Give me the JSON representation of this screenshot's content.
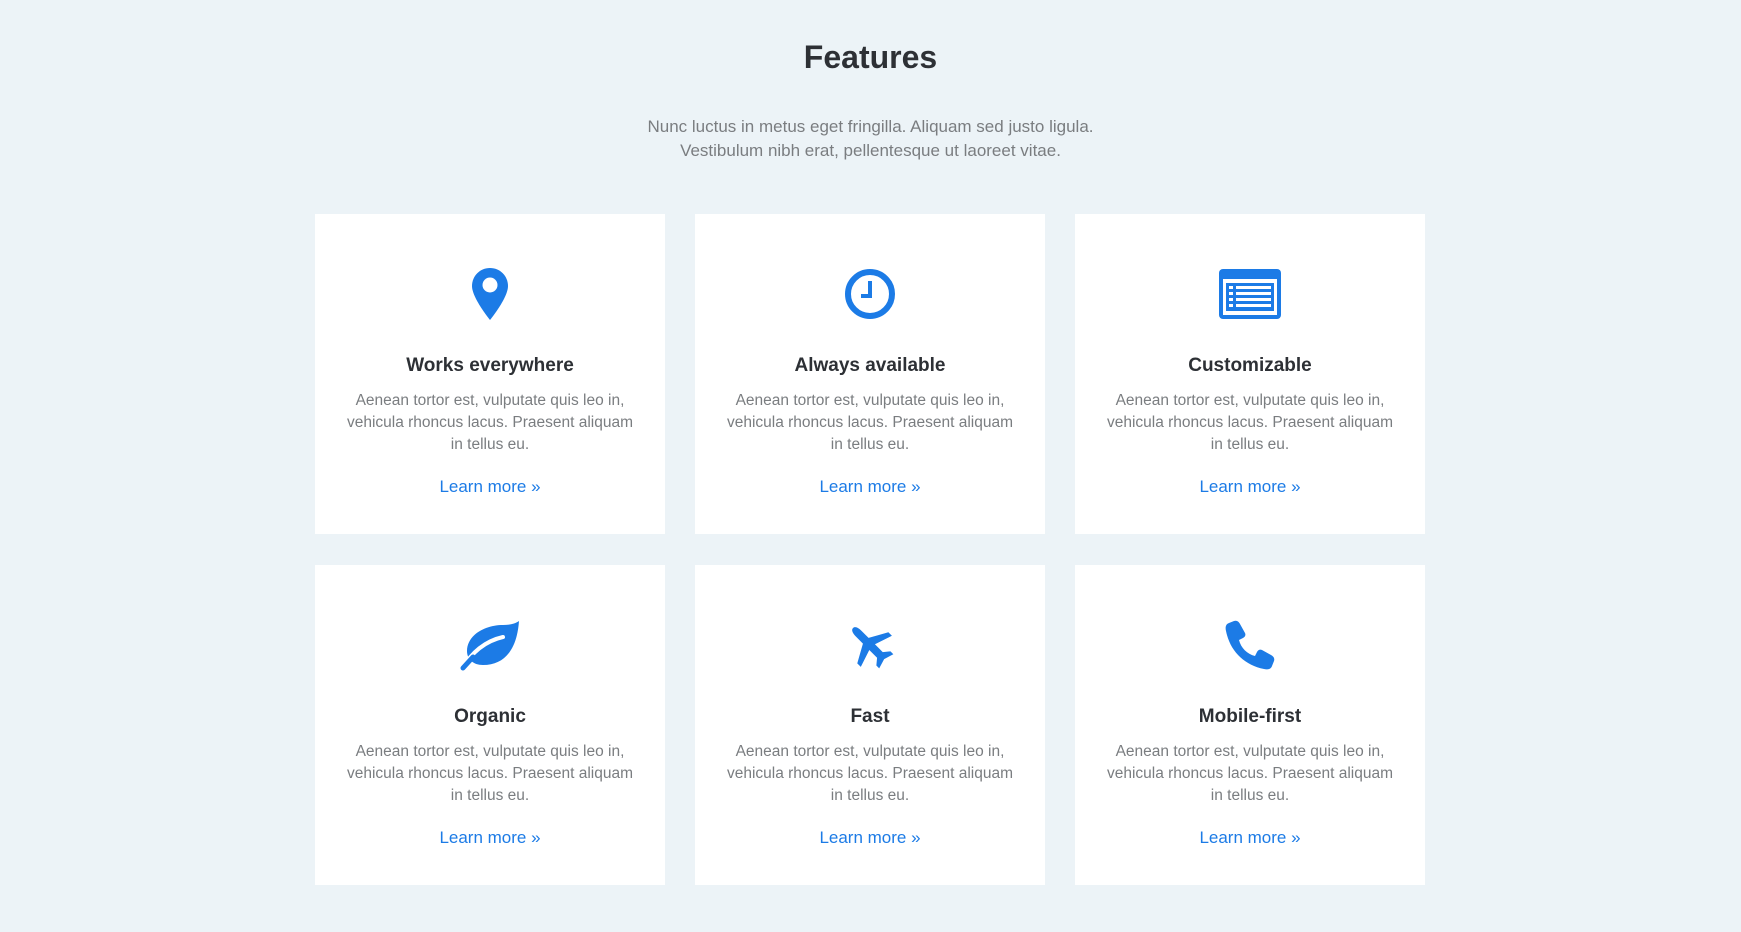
{
  "header": {
    "title": "Features",
    "subtitle_line1": "Nunc luctus in metus eget fringilla. Aliquam sed justo ligula.",
    "subtitle_line2": "Vestibulum nibh erat, pellentesque ut laoreet vitae."
  },
  "accent_color": "#1c7be6",
  "features": [
    {
      "icon": "map-marker-icon",
      "title": "Works everywhere",
      "text": "Aenean tortor est, vulputate quis leo in, vehicula rhoncus lacus. Praesent aliquam in tellus eu.",
      "link": "Learn more »"
    },
    {
      "icon": "clock-icon",
      "title": "Always available",
      "text": "Aenean tortor est, vulputate quis leo in, vehicula rhoncus lacus. Praesent aliquam in tellus eu.",
      "link": "Learn more »"
    },
    {
      "icon": "list-icon",
      "title": "Customizable",
      "text": "Aenean tortor est, vulputate quis leo in, vehicula rhoncus lacus. Praesent aliquam in tellus eu.",
      "link": "Learn more »"
    },
    {
      "icon": "leaf-icon",
      "title": "Organic",
      "text": "Aenean tortor est, vulputate quis leo in, vehicula rhoncus lacus. Praesent aliquam in tellus eu.",
      "link": "Learn more »"
    },
    {
      "icon": "plane-icon",
      "title": "Fast",
      "text": "Aenean tortor est, vulputate quis leo in, vehicula rhoncus lacus. Praesent aliquam in tellus eu.",
      "link": "Learn more »"
    },
    {
      "icon": "phone-icon",
      "title": "Mobile-first",
      "text": "Aenean tortor est, vulputate quis leo in, vehicula rhoncus lacus. Praesent aliquam in tellus eu.",
      "link": "Learn more »"
    }
  ]
}
